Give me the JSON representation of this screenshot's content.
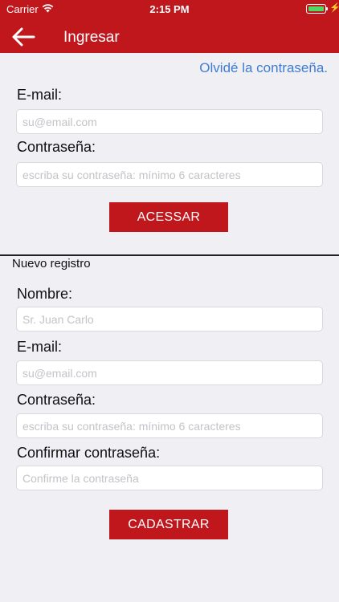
{
  "status_bar": {
    "carrier": "Carrier",
    "time": "2:15 PM"
  },
  "header": {
    "title": "Ingresar"
  },
  "login": {
    "forgot_link": "Olvidé la contraseña.",
    "email_label": "E-mail:",
    "email_placeholder": "su@email.com",
    "password_label": "Contraseña:",
    "password_placeholder": "escriba su contraseña: mínimo 6 caracteres",
    "submit_label": "ACESSAR"
  },
  "register": {
    "section_title": "Nuevo registro",
    "name_label": "Nombre:",
    "name_placeholder": "Sr. Juan Carlo",
    "email_label": "E-mail:",
    "email_placeholder": "su@email.com",
    "password_label": "Contraseña:",
    "password_placeholder": "escriba su contraseña: mínimo 6 caracteres",
    "confirm_label": "Confirmar contraseña:",
    "confirm_placeholder": "Confirme la contraseña",
    "submit_label": "CADASTRAR"
  },
  "colors": {
    "accent": "#c0171d",
    "link": "#3f7dd0",
    "background": "#efeff4",
    "battery": "#4cd964"
  },
  "icons": {
    "back": "arrow-left-icon",
    "wifi": "wifi-icon",
    "battery": "battery-icon",
    "charging": "bolt-icon"
  }
}
